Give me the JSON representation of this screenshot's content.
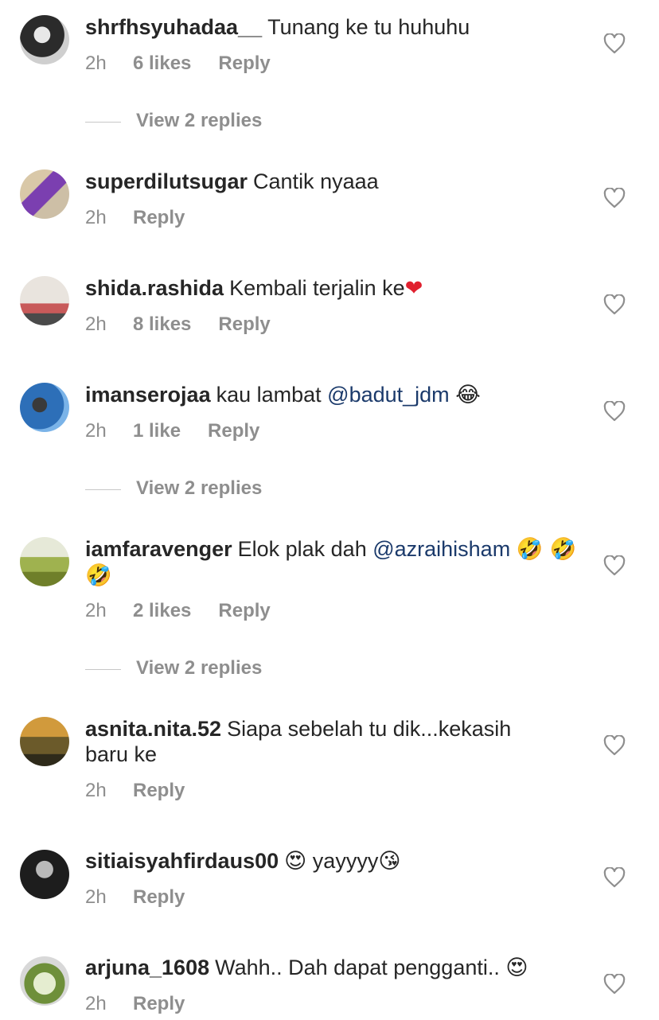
{
  "comments": [
    {
      "username": "shrfhsyuhadaa__",
      "text": "Tunang ke tu huhuhu",
      "time": "2h",
      "likes": "6 likes",
      "reply": "Reply",
      "view_replies": "View 2 replies",
      "avatar_colors": [
        "#2b2b2b",
        "#e8e8e8"
      ]
    },
    {
      "username": "superdilutsugar",
      "text": "Cantik nyaaa",
      "time": "2h",
      "likes": "",
      "reply": "Reply",
      "view_replies": "",
      "avatar_colors": [
        "#7b3fb0",
        "#d9c8a8"
      ]
    },
    {
      "username": "shida.rashida",
      "text": "Kembali terjalin ke",
      "emoji_after": "❤",
      "time": "2h",
      "likes": "8 likes",
      "reply": "Reply",
      "view_replies": "",
      "avatar_colors": [
        "#c85a5a",
        "#e9e4de"
      ]
    },
    {
      "username": "imanserojaa",
      "text": "kau lambat ",
      "mention": "@badut_jdm",
      "emoji_after": "😂",
      "time": "2h",
      "likes": "1 like",
      "reply": "Reply",
      "view_replies": "View 2 replies",
      "avatar_colors": [
        "#2d6fb8",
        "#7ab3e8"
      ]
    },
    {
      "username": "iamfaravenger",
      "text": "Elok plak dah ",
      "mention": "@azraihisham",
      "emoji_after": "🤣 🤣🤣",
      "time": "2h",
      "likes": "2 likes",
      "reply": "Reply",
      "view_replies": "View 2 replies",
      "avatar_colors": [
        "#9fb24f",
        "#d8e2a8"
      ]
    },
    {
      "username": "asnita.nita.52",
      "text": "Siapa sebelah tu dik...kekasih baru ke",
      "time": "2h",
      "likes": "",
      "reply": "Reply",
      "view_replies": "",
      "avatar_colors": [
        "#6b5a2a",
        "#d19a3c"
      ]
    },
    {
      "username": "sitiaisyahfirdaus00",
      "text": "",
      "emoji_before": "😍",
      "text_after": "yayyyy",
      "emoji_after": "😘",
      "time": "2h",
      "likes": "",
      "reply": "Reply",
      "view_replies": "",
      "avatar_colors": [
        "#1d1d1d",
        "#b9b9b9"
      ]
    },
    {
      "username": "arjuna_1608",
      "text": "Wahh.. Dah dapat pengganti.. ",
      "emoji_after": "😍",
      "time": "2h",
      "likes": "",
      "reply": "Reply",
      "view_replies": "",
      "avatar_colors": [
        "#6e8f3a",
        "#e5edd0"
      ]
    }
  ],
  "colors": {
    "text": "#262626",
    "meta": "#8e8e8e",
    "mention": "#1b3a6b",
    "heart_outline": "#8e8e8e",
    "red_heart": "#e0202e"
  },
  "icons": {
    "like": "heart-outline-icon"
  }
}
